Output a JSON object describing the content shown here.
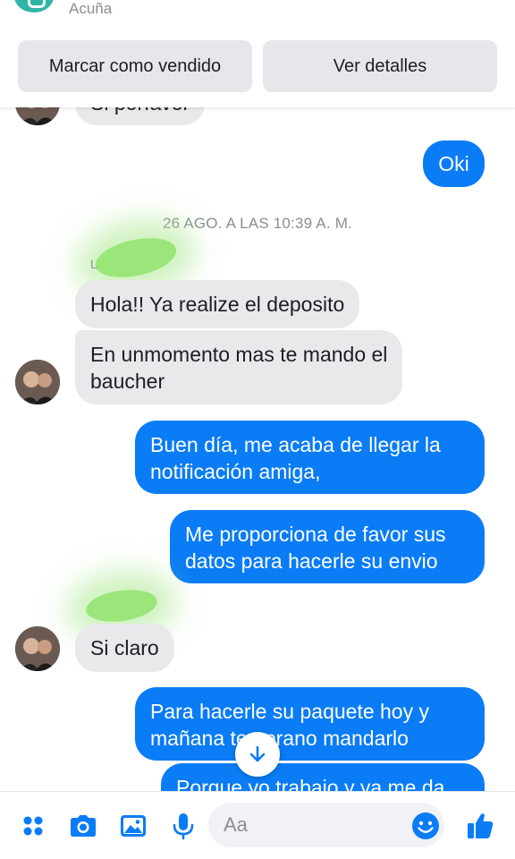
{
  "header": {
    "seller_name": "Acuña",
    "mark_sold_label": "Marcar como vendido",
    "details_label": "Ver detalles"
  },
  "messages": {
    "partial_top": "Si porfavor",
    "oki": "Oki",
    "timestamp": "26 AGO. A LAS 10:39 A. M.",
    "sender_initial": "L",
    "m1": "Hola!! Ya realize el deposito",
    "m2_line1": "En unmomento mas te mando el",
    "m2_line2": "baucher",
    "m3_line1": "Buen día, me acaba de llegar la",
    "m3_line2": "notificación amiga,",
    "m4_line1": "Me proporciona de favor sus",
    "m4_line2": "datos para hacerle su envio",
    "m5": "Si claro",
    "m6_line1": "Para hacerle su paquete hoy y",
    "m6_line2": "mañana temprano mandarlo",
    "m7": "Porque yo trabajo y ya me da"
  },
  "composer": {
    "placeholder": "Aa"
  },
  "icons": {
    "menu": "four-dots-icon",
    "camera": "camera-icon",
    "gallery": "image-icon",
    "mic": "microphone-icon",
    "emoji": "emoji-icon",
    "like": "thumbs-up-icon",
    "scroll": "arrow-down-icon"
  },
  "colors": {
    "accent": "#0a7cf6",
    "incoming_bubble": "#e9e9ec",
    "seller_icon": "#2fb5a6"
  }
}
